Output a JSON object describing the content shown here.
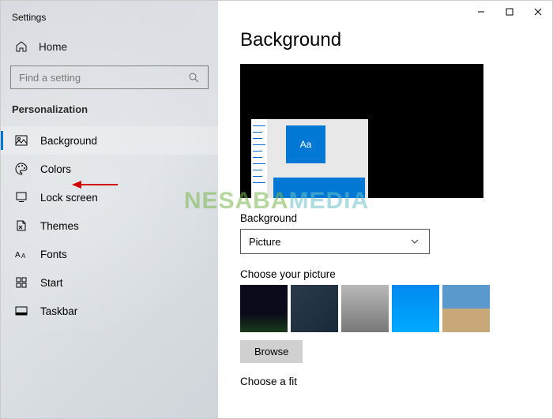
{
  "app_title": "Settings",
  "home_label": "Home",
  "search": {
    "placeholder": "Find a setting"
  },
  "category": "Personalization",
  "nav": [
    {
      "label": "Background"
    },
    {
      "label": "Colors"
    },
    {
      "label": "Lock screen"
    },
    {
      "label": "Themes"
    },
    {
      "label": "Fonts"
    },
    {
      "label": "Start"
    },
    {
      "label": "Taskbar"
    }
  ],
  "page": {
    "title": "Background",
    "preview_text": "Aa",
    "bg_label": "Background",
    "bg_value": "Picture",
    "choose_pic_label": "Choose your picture",
    "browse_label": "Browse",
    "choose_fit_label": "Choose a fit"
  },
  "watermark": {
    "part1": "NESABA",
    "part2": "MEDIA"
  }
}
